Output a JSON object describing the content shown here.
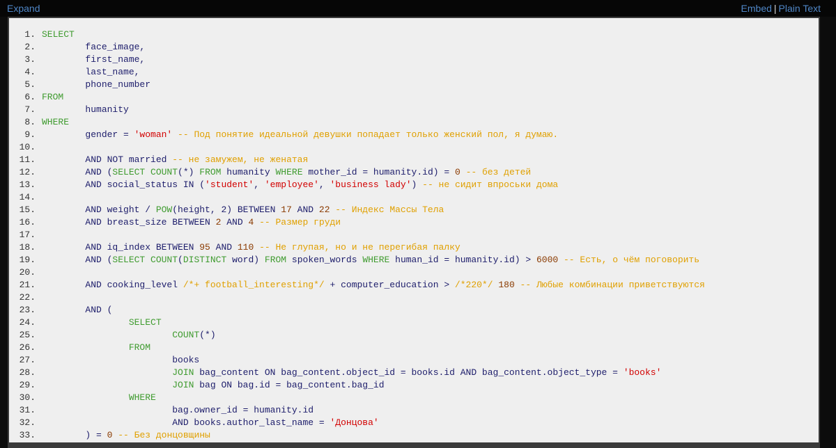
{
  "toolbar": {
    "expand": "Expand",
    "embed": "Embed",
    "separator": "|",
    "plain_text": "Plain Text"
  },
  "colors": {
    "keyword": "#3f9b2f",
    "string": "#d20000",
    "comment": "#e0a000",
    "number": "#8a3a00",
    "identifier": "#1d1d6b",
    "code_background": "#efefef",
    "link": "#4f86c6"
  },
  "code": {
    "lines": [
      {
        "num": "1.",
        "segs": [
          [
            "kw",
            "SELECT"
          ]
        ]
      },
      {
        "num": "2.",
        "segs": [
          [
            "id",
            "        face_image,"
          ]
        ]
      },
      {
        "num": "3.",
        "segs": [
          [
            "id",
            "        first_name,"
          ]
        ]
      },
      {
        "num": "4.",
        "segs": [
          [
            "id",
            "        last_name,"
          ]
        ]
      },
      {
        "num": "5.",
        "segs": [
          [
            "id",
            "        phone_number"
          ]
        ]
      },
      {
        "num": "6.",
        "segs": [
          [
            "kw",
            "FROM"
          ]
        ]
      },
      {
        "num": "7.",
        "segs": [
          [
            "id",
            "        humanity"
          ]
        ]
      },
      {
        "num": "8.",
        "segs": [
          [
            "kw",
            "WHERE"
          ]
        ]
      },
      {
        "num": "9.",
        "segs": [
          [
            "id",
            "        gender = "
          ],
          [
            "str",
            "'woman'"
          ],
          [
            "cm",
            " -- Под понятие идеальной девушки попадает только женский пол, я думаю."
          ]
        ]
      },
      {
        "num": "10.",
        "segs": []
      },
      {
        "num": "11.",
        "segs": [
          [
            "id",
            "        AND NOT married"
          ],
          [
            "cm",
            " -- не замужем, не женатая"
          ]
        ]
      },
      {
        "num": "12.",
        "segs": [
          [
            "id",
            "        AND ("
          ],
          [
            "kw",
            "SELECT COUNT"
          ],
          [
            "id",
            "(*) "
          ],
          [
            "kw",
            "FROM"
          ],
          [
            "id",
            " humanity "
          ],
          [
            "kw",
            "WHERE"
          ],
          [
            "id",
            " mother_id = humanity.id) = "
          ],
          [
            "num",
            "0"
          ],
          [
            "cm",
            " -- без детей"
          ]
        ]
      },
      {
        "num": "13.",
        "segs": [
          [
            "id",
            "        AND social_status IN ("
          ],
          [
            "str",
            "'student'"
          ],
          [
            "id",
            ", "
          ],
          [
            "str",
            "'employee'"
          ],
          [
            "id",
            ", "
          ],
          [
            "str",
            "'business lady'"
          ],
          [
            "id",
            ")"
          ],
          [
            "cm",
            " -- не сидит впроськи дома"
          ]
        ]
      },
      {
        "num": "14.",
        "segs": []
      },
      {
        "num": "15.",
        "segs": [
          [
            "id",
            "        AND weight / "
          ],
          [
            "kw",
            "POW"
          ],
          [
            "id",
            "(height, 2) BETWEEN "
          ],
          [
            "num",
            "17"
          ],
          [
            "id",
            " AND "
          ],
          [
            "num",
            "22"
          ],
          [
            "cm",
            " -- Индекс Массы Тела"
          ]
        ]
      },
      {
        "num": "16.",
        "segs": [
          [
            "id",
            "        AND breast_size BETWEEN "
          ],
          [
            "num",
            "2"
          ],
          [
            "id",
            " AND "
          ],
          [
            "num",
            "4"
          ],
          [
            "cm",
            " -- Размер груди"
          ]
        ]
      },
      {
        "num": "17.",
        "segs": []
      },
      {
        "num": "18.",
        "segs": [
          [
            "id",
            "        AND iq_index BETWEEN "
          ],
          [
            "num",
            "95"
          ],
          [
            "id",
            " AND "
          ],
          [
            "num",
            "110"
          ],
          [
            "cm",
            " -- Не глупая, но и не перегибая палку"
          ]
        ]
      },
      {
        "num": "19.",
        "segs": [
          [
            "id",
            "        AND ("
          ],
          [
            "kw",
            "SELECT COUNT"
          ],
          [
            "id",
            "("
          ],
          [
            "kw",
            "DISTINCT"
          ],
          [
            "id",
            " word) "
          ],
          [
            "kw",
            "FROM"
          ],
          [
            "id",
            " spoken_words "
          ],
          [
            "kw",
            "WHERE"
          ],
          [
            "id",
            " human_id = humanity.id) > "
          ],
          [
            "num",
            "6000"
          ],
          [
            "cm",
            " -- Есть, о чём поговорить"
          ]
        ]
      },
      {
        "num": "20.",
        "segs": []
      },
      {
        "num": "21.",
        "segs": [
          [
            "id",
            "        AND cooking_level "
          ],
          [
            "cm",
            "/*+ football_interesting*/"
          ],
          [
            "id",
            " + computer_education > "
          ],
          [
            "cm",
            "/*220*/"
          ],
          [
            "id",
            " "
          ],
          [
            "num",
            "180"
          ],
          [
            "cm",
            " -- Любые комбинации приветствуются"
          ]
        ]
      },
      {
        "num": "22.",
        "segs": []
      },
      {
        "num": "23.",
        "segs": [
          [
            "id",
            "        AND ("
          ]
        ]
      },
      {
        "num": "24.",
        "segs": [
          [
            "kw",
            "                SELECT"
          ]
        ]
      },
      {
        "num": "25.",
        "segs": [
          [
            "id",
            "                        "
          ],
          [
            "kw",
            "COUNT"
          ],
          [
            "id",
            "(*)"
          ]
        ]
      },
      {
        "num": "26.",
        "segs": [
          [
            "kw",
            "                FROM"
          ]
        ]
      },
      {
        "num": "27.",
        "segs": [
          [
            "id",
            "                        books"
          ]
        ]
      },
      {
        "num": "28.",
        "segs": [
          [
            "id",
            "                        "
          ],
          [
            "kw",
            "JOIN"
          ],
          [
            "id",
            " bag_content ON bag_content.object_id = books.id AND bag_content.object_type = "
          ],
          [
            "str",
            "'books'"
          ]
        ]
      },
      {
        "num": "29.",
        "segs": [
          [
            "id",
            "                        "
          ],
          [
            "kw",
            "JOIN"
          ],
          [
            "id",
            " bag ON bag.id = bag_content.bag_id"
          ]
        ]
      },
      {
        "num": "30.",
        "segs": [
          [
            "kw",
            "                WHERE"
          ]
        ]
      },
      {
        "num": "31.",
        "segs": [
          [
            "id",
            "                        bag.owner_id = humanity.id"
          ]
        ]
      },
      {
        "num": "32.",
        "segs": [
          [
            "id",
            "                        AND books.author_last_name = "
          ],
          [
            "str",
            "'Донцова'"
          ]
        ]
      },
      {
        "num": "33.",
        "segs": [
          [
            "id",
            "        ) = "
          ],
          [
            "num",
            "0"
          ],
          [
            "cm",
            " -- Без донцовщины"
          ]
        ]
      }
    ]
  }
}
